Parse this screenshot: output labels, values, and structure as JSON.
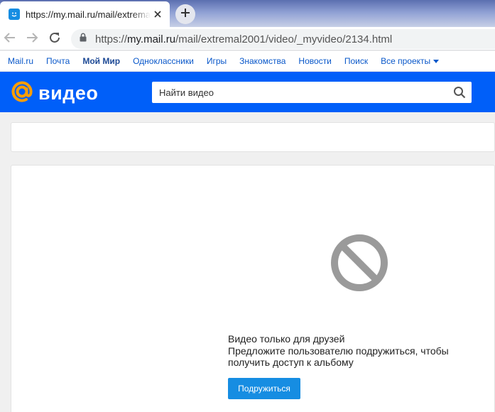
{
  "browser": {
    "tab_title": "https://my.mail.ru/mail/extremal2001/video/_myvideo/2134.html",
    "url_scheme": "https://",
    "url_host": "my.mail.ru",
    "url_path": "/mail/extremal2001/video/_myvideo/2134.html"
  },
  "portal_nav": {
    "items": [
      "Mail.ru",
      "Почта",
      "Мой Мир",
      "Одноклассники",
      "Игры",
      "Знакомства",
      "Новости",
      "Поиск"
    ],
    "more_label": "Все проекты"
  },
  "video_header": {
    "logo_text": "видео",
    "search_placeholder": "Найти видео"
  },
  "content": {
    "message_title": "Видео только для друзей",
    "message_body": "Предложите пользователю подружиться, чтобы получить доступ к альбому",
    "button_label": "Подружиться"
  },
  "colors": {
    "header_bg": "#005ff9",
    "logo_accent": "#ff9e00",
    "button_bg": "#168de2",
    "link": "#0a58ca"
  },
  "icons": [
    "mail-ru-favicon",
    "close-icon",
    "plus-icon",
    "back-arrow-icon",
    "forward-arrow-icon",
    "reload-icon",
    "lock-icon",
    "caret-down-icon",
    "at-sign-icon",
    "search-icon",
    "blocked-icon"
  ]
}
